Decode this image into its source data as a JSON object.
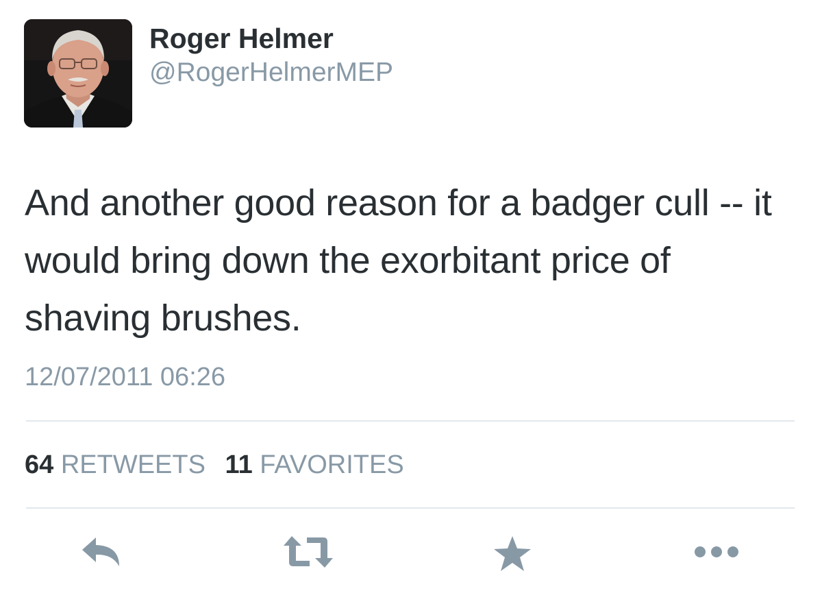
{
  "author": {
    "display_name": "Roger Helmer",
    "handle": "@RogerHelmerMEP",
    "avatar_icon": "profile-photo"
  },
  "tweet": {
    "text": "And another good reason for a badger cull -- it would bring down the exorbitant price of shaving brushes.",
    "timestamp": "12/07/2011 06:26"
  },
  "stats": {
    "retweets_count": "64",
    "retweets_label": "RETWEETS",
    "favorites_count": "11",
    "favorites_label": "FAVORITES"
  },
  "actions": [
    {
      "icon": "reply-icon"
    },
    {
      "icon": "retweet-icon"
    },
    {
      "icon": "star-icon"
    },
    {
      "icon": "more-icon"
    }
  ],
  "colors": {
    "text": "#292f33",
    "muted": "#8899a6",
    "divider": "#e1e8ed",
    "action_icon": "#8899a6"
  }
}
